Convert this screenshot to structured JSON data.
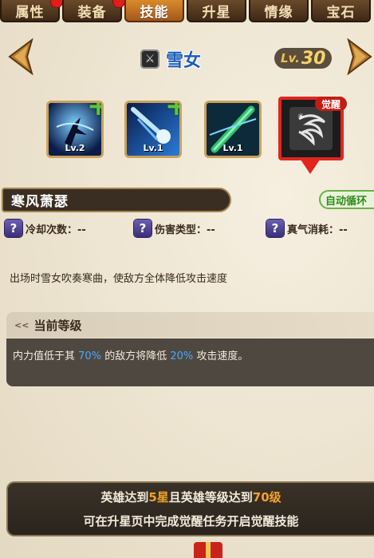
{
  "tabs": [
    {
      "label": "属性",
      "badge": true
    },
    {
      "label": "装备",
      "badge": true
    },
    {
      "label": "技能",
      "active": true
    },
    {
      "label": "升星"
    },
    {
      "label": "情缘"
    },
    {
      "label": "宝石"
    }
  ],
  "hero": {
    "name": "雪女",
    "level_prefix": "Lv.",
    "level": "30"
  },
  "skills": [
    {
      "level": "Lv.2",
      "upgradable": true,
      "icon": "ice-dancer-icon"
    },
    {
      "level": "Lv.1",
      "upgradable": true,
      "icon": "ice-comet-icon"
    },
    {
      "level": "Lv.1",
      "upgradable": false,
      "icon": "jade-flute-icon"
    },
    {
      "level": "",
      "badge": "觉醒",
      "selected": true,
      "icon": "whirlwind-icon"
    }
  ],
  "skill_detail": {
    "title": "寒风萧瑟",
    "auto_badge": "自动循环",
    "stats": [
      {
        "label": "冷却次数：--"
      },
      {
        "label": "伤害类型：--"
      },
      {
        "label": "真气消耗：--"
      }
    ],
    "description": "出场时雪女吹奏寒曲，使敌方全体降低攻击速度"
  },
  "current_level": {
    "header": "当前等级",
    "text_1": "内力值低于其",
    "value_1": "70%",
    "text_2": "的敌方将降低",
    "value_2": "20%",
    "text_3": "攻击速度。"
  },
  "requirement": {
    "l1_a": "英雄达到",
    "l1_b": "5星",
    "l1_c": "且英雄等级达到",
    "l1_d": "70级",
    "line2": "可在升星页中完成觉醒任务开启觉醒技能"
  },
  "colors": {
    "accent": "#d98a2c",
    "highlight_blue": "#4aa8ff",
    "gold": "#f4a12a",
    "awaken_red": "#e0261e"
  }
}
